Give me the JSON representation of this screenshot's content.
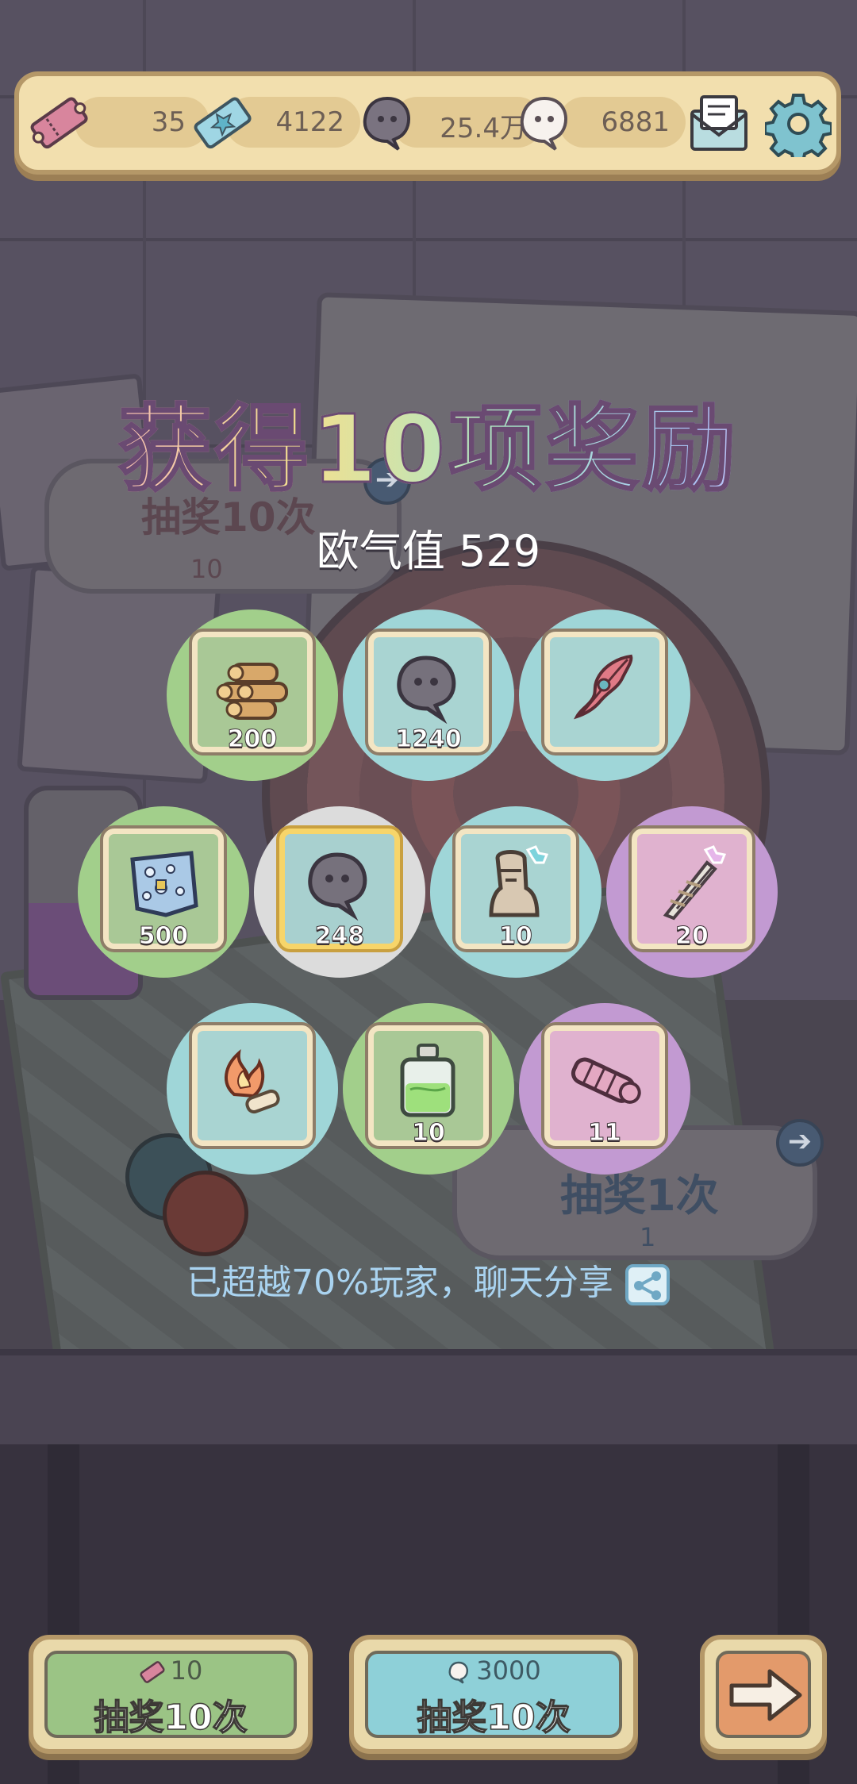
{
  "resources": {
    "tickets": "35",
    "crystals": "4122",
    "dark_souls": "25.4万",
    "light_souls": "6881"
  },
  "background": {
    "left_bubble_title": "抽奖10次",
    "left_bubble_cost": "10",
    "right_bubble_title": "抽奖1次",
    "right_bubble_cost": "1"
  },
  "result": {
    "title": "获得10项奖励",
    "luck": "欧气值 529",
    "share_text": "已超越70%玩家，聊天分享",
    "items": [
      {
        "icon": "wood-logs-icon",
        "quantity": "200",
        "rarity": "green"
      },
      {
        "icon": "dark-soul-icon",
        "quantity": "1240",
        "rarity": "cyan"
      },
      {
        "icon": "red-feather-icon",
        "quantity": "",
        "rarity": "cyan"
      },
      {
        "icon": "blue-map-icon",
        "quantity": "500",
        "rarity": "green"
      },
      {
        "icon": "dark-soul-icon",
        "quantity": "248",
        "rarity": "white"
      },
      {
        "icon": "moai-statue-icon",
        "quantity": "10",
        "rarity": "cyan"
      },
      {
        "icon": "bandaged-blade-icon",
        "quantity": "20",
        "rarity": "purple"
      },
      {
        "icon": "flaming-scroll-icon",
        "quantity": "",
        "rarity": "cyan"
      },
      {
        "icon": "green-potion-icon",
        "quantity": "10",
        "rarity": "green"
      },
      {
        "icon": "pink-cannon-icon",
        "quantity": "11",
        "rarity": "purple"
      }
    ]
  },
  "buttons": {
    "draw_ticket_cost": "10",
    "draw_ticket_label": "抽奖10次",
    "draw_soul_cost": "3000",
    "draw_soul_label": "抽奖10次"
  },
  "colors": {
    "bar_bg": "#f2dfae",
    "rarity_green": "#a2cf8b",
    "rarity_cyan": "#9fd6d8",
    "rarity_purple": "#c29ad2",
    "rarity_white": "#dcdcdc"
  }
}
